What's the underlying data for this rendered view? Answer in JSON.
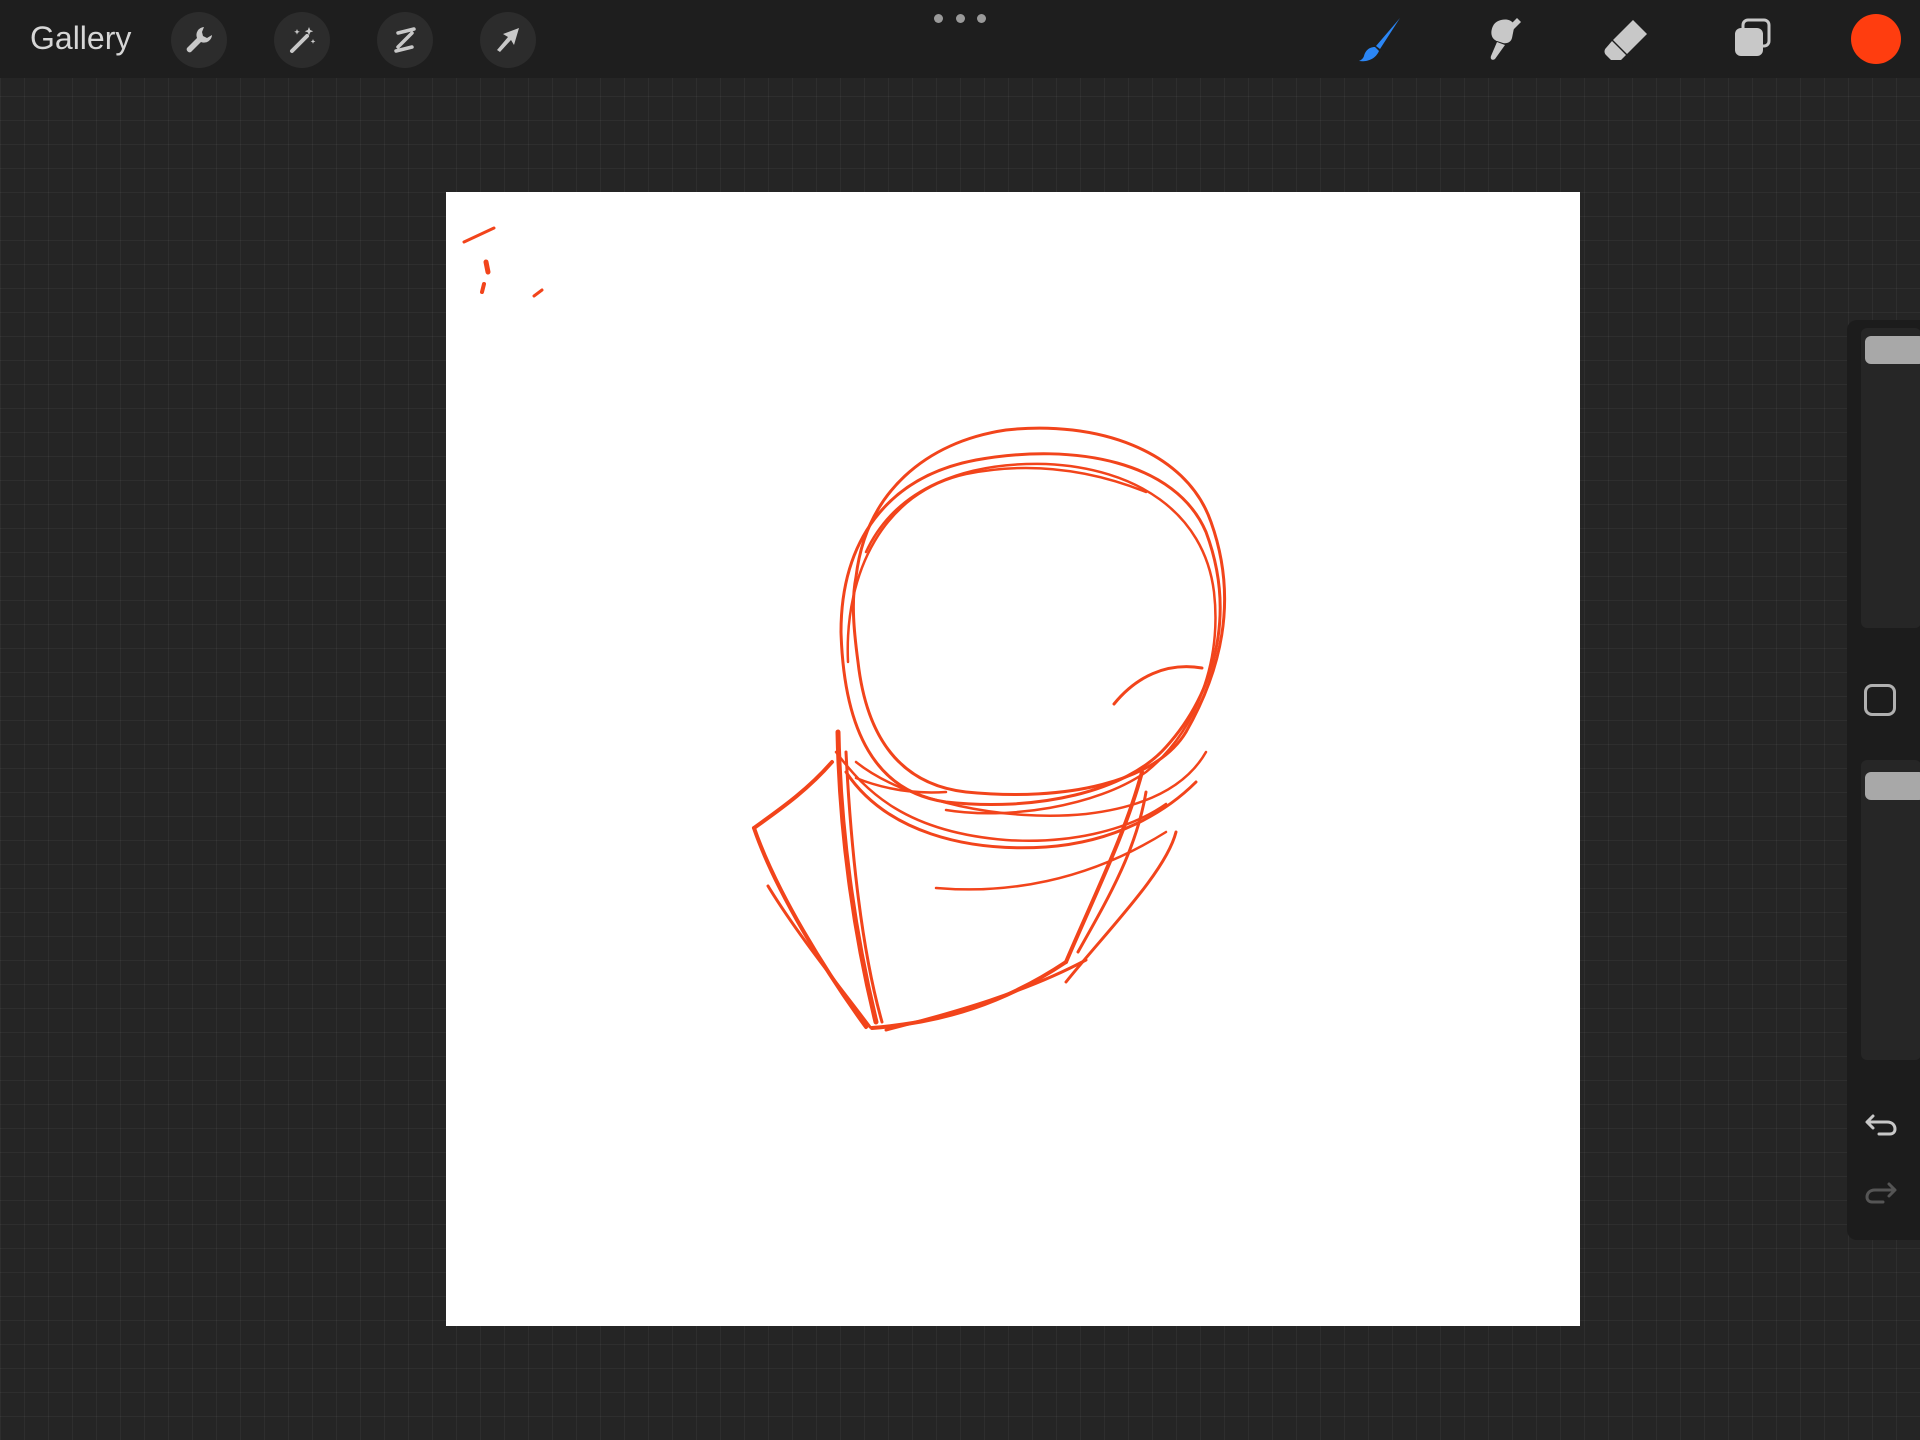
{
  "topbar": {
    "gallery_label": "Gallery",
    "left_tools": [
      {
        "name": "actions",
        "icon": "wrench-icon"
      },
      {
        "name": "adjustments",
        "icon": "magic-wand-icon"
      },
      {
        "name": "selection",
        "icon": "selection-s-icon"
      },
      {
        "name": "transform",
        "icon": "arrow-cursor-icon"
      }
    ],
    "more_icon": "more-dots-icon",
    "right_tools": [
      {
        "name": "brush",
        "icon": "brush-icon",
        "active": true
      },
      {
        "name": "smudge",
        "icon": "smudge-icon",
        "active": false
      },
      {
        "name": "eraser",
        "icon": "eraser-icon",
        "active": false
      },
      {
        "name": "layers",
        "icon": "layers-icon",
        "active": false
      }
    ],
    "current_color": "#ff3d0f"
  },
  "canvas": {
    "background": "#ffffff",
    "stroke_color": "#f2441b"
  },
  "sidebar": {
    "brush_size_slider": {
      "thumb_position": "top"
    },
    "modify_button_icon": "square-outline-icon",
    "opacity_slider": {
      "thumb_position": "top"
    },
    "undo_icon": "undo-icon",
    "redo_icon": "redo-icon"
  },
  "colors": {
    "accent_blue": "#2b86f5",
    "icon_gray": "#c8c8c8",
    "toolbar_bg": "#1e1e1e",
    "workspace_bg": "#252525"
  }
}
